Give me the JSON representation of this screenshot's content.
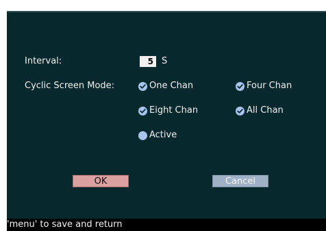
{
  "settings": {
    "interval_label": "Interval:",
    "interval_value": "5",
    "interval_unit": "S",
    "cyclic_mode_label": "Cyclic Screen Mode:"
  },
  "modes": [
    {
      "label": "One Chan",
      "state": "checked"
    },
    {
      "label": "Four Chan",
      "state": "checked"
    },
    {
      "label": "Eight Chan",
      "state": "checked"
    },
    {
      "label": "All Chan",
      "state": "checked"
    },
    {
      "label": "Active",
      "state": "unchecked"
    }
  ],
  "buttons": {
    "ok_label": "OK",
    "cancel_label": "Cancel"
  },
  "status_bar": {
    "text": "'menu' to save and return"
  },
  "colors": {
    "panel_background": "#07282d",
    "ok_button": "#dba0a0",
    "cancel_button": "#9fb1c4",
    "radio": "#a9c4ec",
    "text": "#f2f2f2"
  },
  "icons": {
    "checked": "check-radio-icon",
    "unchecked": "empty-radio-icon"
  }
}
